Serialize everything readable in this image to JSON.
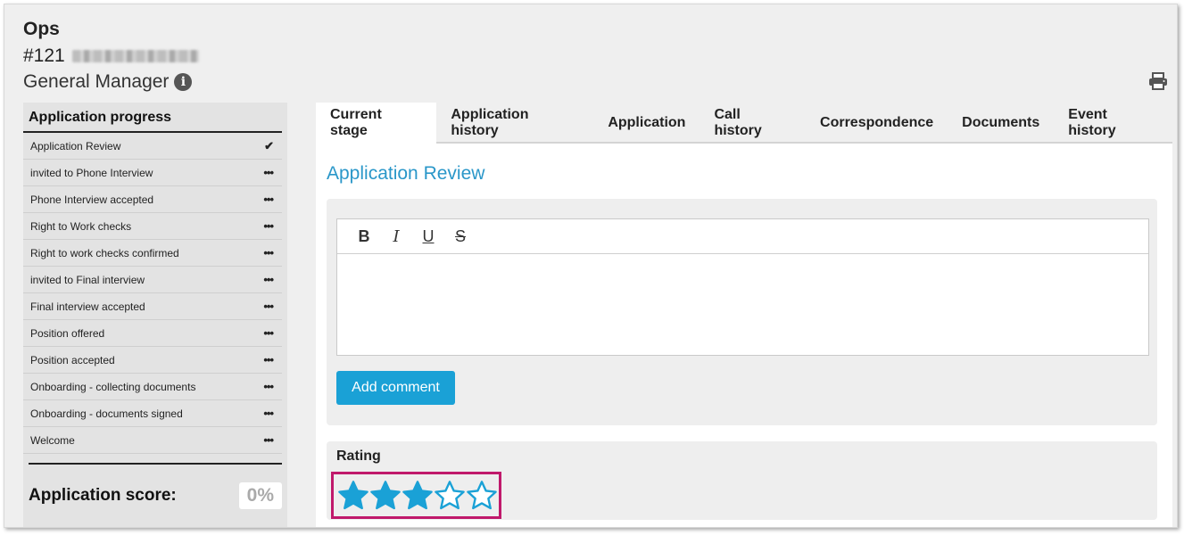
{
  "header": {
    "title": "Ops",
    "ref": "#121",
    "role": "General Manager"
  },
  "progress": {
    "title": "Application progress",
    "stages": [
      {
        "label": "Application Review",
        "mark": "✔"
      },
      {
        "label": "invited to Phone Interview",
        "mark": "•••"
      },
      {
        "label": "Phone Interview accepted",
        "mark": "•••"
      },
      {
        "label": "Right to Work checks",
        "mark": "•••"
      },
      {
        "label": "Right to work checks confirmed",
        "mark": "•••"
      },
      {
        "label": "invited to Final interview",
        "mark": "•••"
      },
      {
        "label": "Final interview accepted",
        "mark": "•••"
      },
      {
        "label": "Position offered",
        "mark": "•••"
      },
      {
        "label": "Position accepted",
        "mark": "•••"
      },
      {
        "label": "Onboarding - collecting documents",
        "mark": "•••"
      },
      {
        "label": "Onboarding - documents signed",
        "mark": "•••"
      },
      {
        "label": "Welcome",
        "mark": "•••"
      }
    ],
    "score_label": "Application score:",
    "score_value": "0%"
  },
  "tabs": [
    {
      "label": "Current stage",
      "active": true
    },
    {
      "label": "Application history",
      "active": false
    },
    {
      "label": "Application",
      "active": false
    },
    {
      "label": "Call history",
      "active": false
    },
    {
      "label": "Correspondence",
      "active": false
    },
    {
      "label": "Documents",
      "active": false
    },
    {
      "label": "Event history",
      "active": false
    }
  ],
  "main": {
    "section_title": "Application Review",
    "toolbar": {
      "bold": "B",
      "italic": "I",
      "underline": "U",
      "strike": "S"
    },
    "add_comment": "Add comment",
    "rating_label": "Rating",
    "rating": {
      "value": 3,
      "max": 5
    }
  },
  "colors": {
    "accent": "#1aa1d6",
    "title_blue": "#2a97c9",
    "highlight": "#c0196b"
  }
}
